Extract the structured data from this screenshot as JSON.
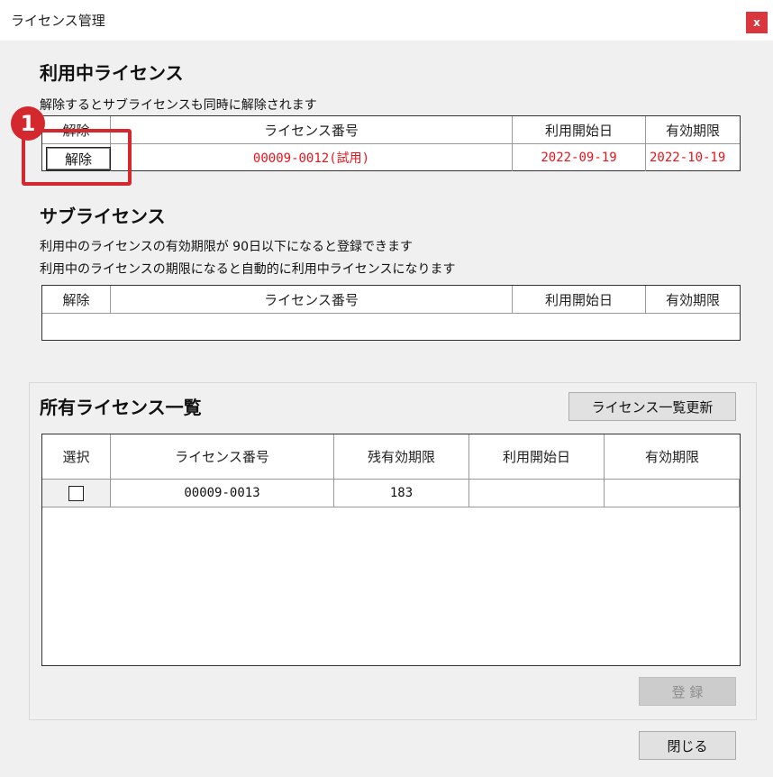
{
  "window": {
    "title": "ライセンス管理",
    "close_label": "x"
  },
  "active_license": {
    "title": "利用中ライセンス",
    "description": "解除するとサブライセンスも同時に解除されます",
    "columns": [
      "解除",
      "ライセンス番号",
      "利用開始日",
      "有効期限"
    ],
    "rows": [
      {
        "button_label": "解除",
        "license_no": "00009-0012(試用)",
        "start_date": "2022-09-19",
        "expiry": "2022-10-19"
      }
    ]
  },
  "sub_license": {
    "title": "サブライセンス",
    "description_1": "利用中のライセンスの有効期限が 90日以下になると登録できます",
    "description_2": "利用中のライセンスの期限になると自動的に利用中ライセンスになります",
    "columns": [
      "解除",
      "ライセンス番号",
      "利用開始日",
      "有効期限"
    ]
  },
  "owned_licenses": {
    "title": "所有ライセンス一覧",
    "refresh_label": "ライセンス一覧更新",
    "columns": [
      "選択",
      "ライセンス番号",
      "残有効期限",
      "利用開始日",
      "有効期限"
    ],
    "rows": [
      {
        "selected": false,
        "license_no": "00009-0013",
        "remaining": "183",
        "start_date": "",
        "expiry": ""
      }
    ],
    "register_label": "登 録"
  },
  "footer": {
    "close_label": "閉じる"
  },
  "annotation": {
    "badge_label": "1"
  },
  "colors": {
    "highlight_red": "#e8141c",
    "annotation_red": "#d3282e",
    "close_red": "#d9363e"
  }
}
